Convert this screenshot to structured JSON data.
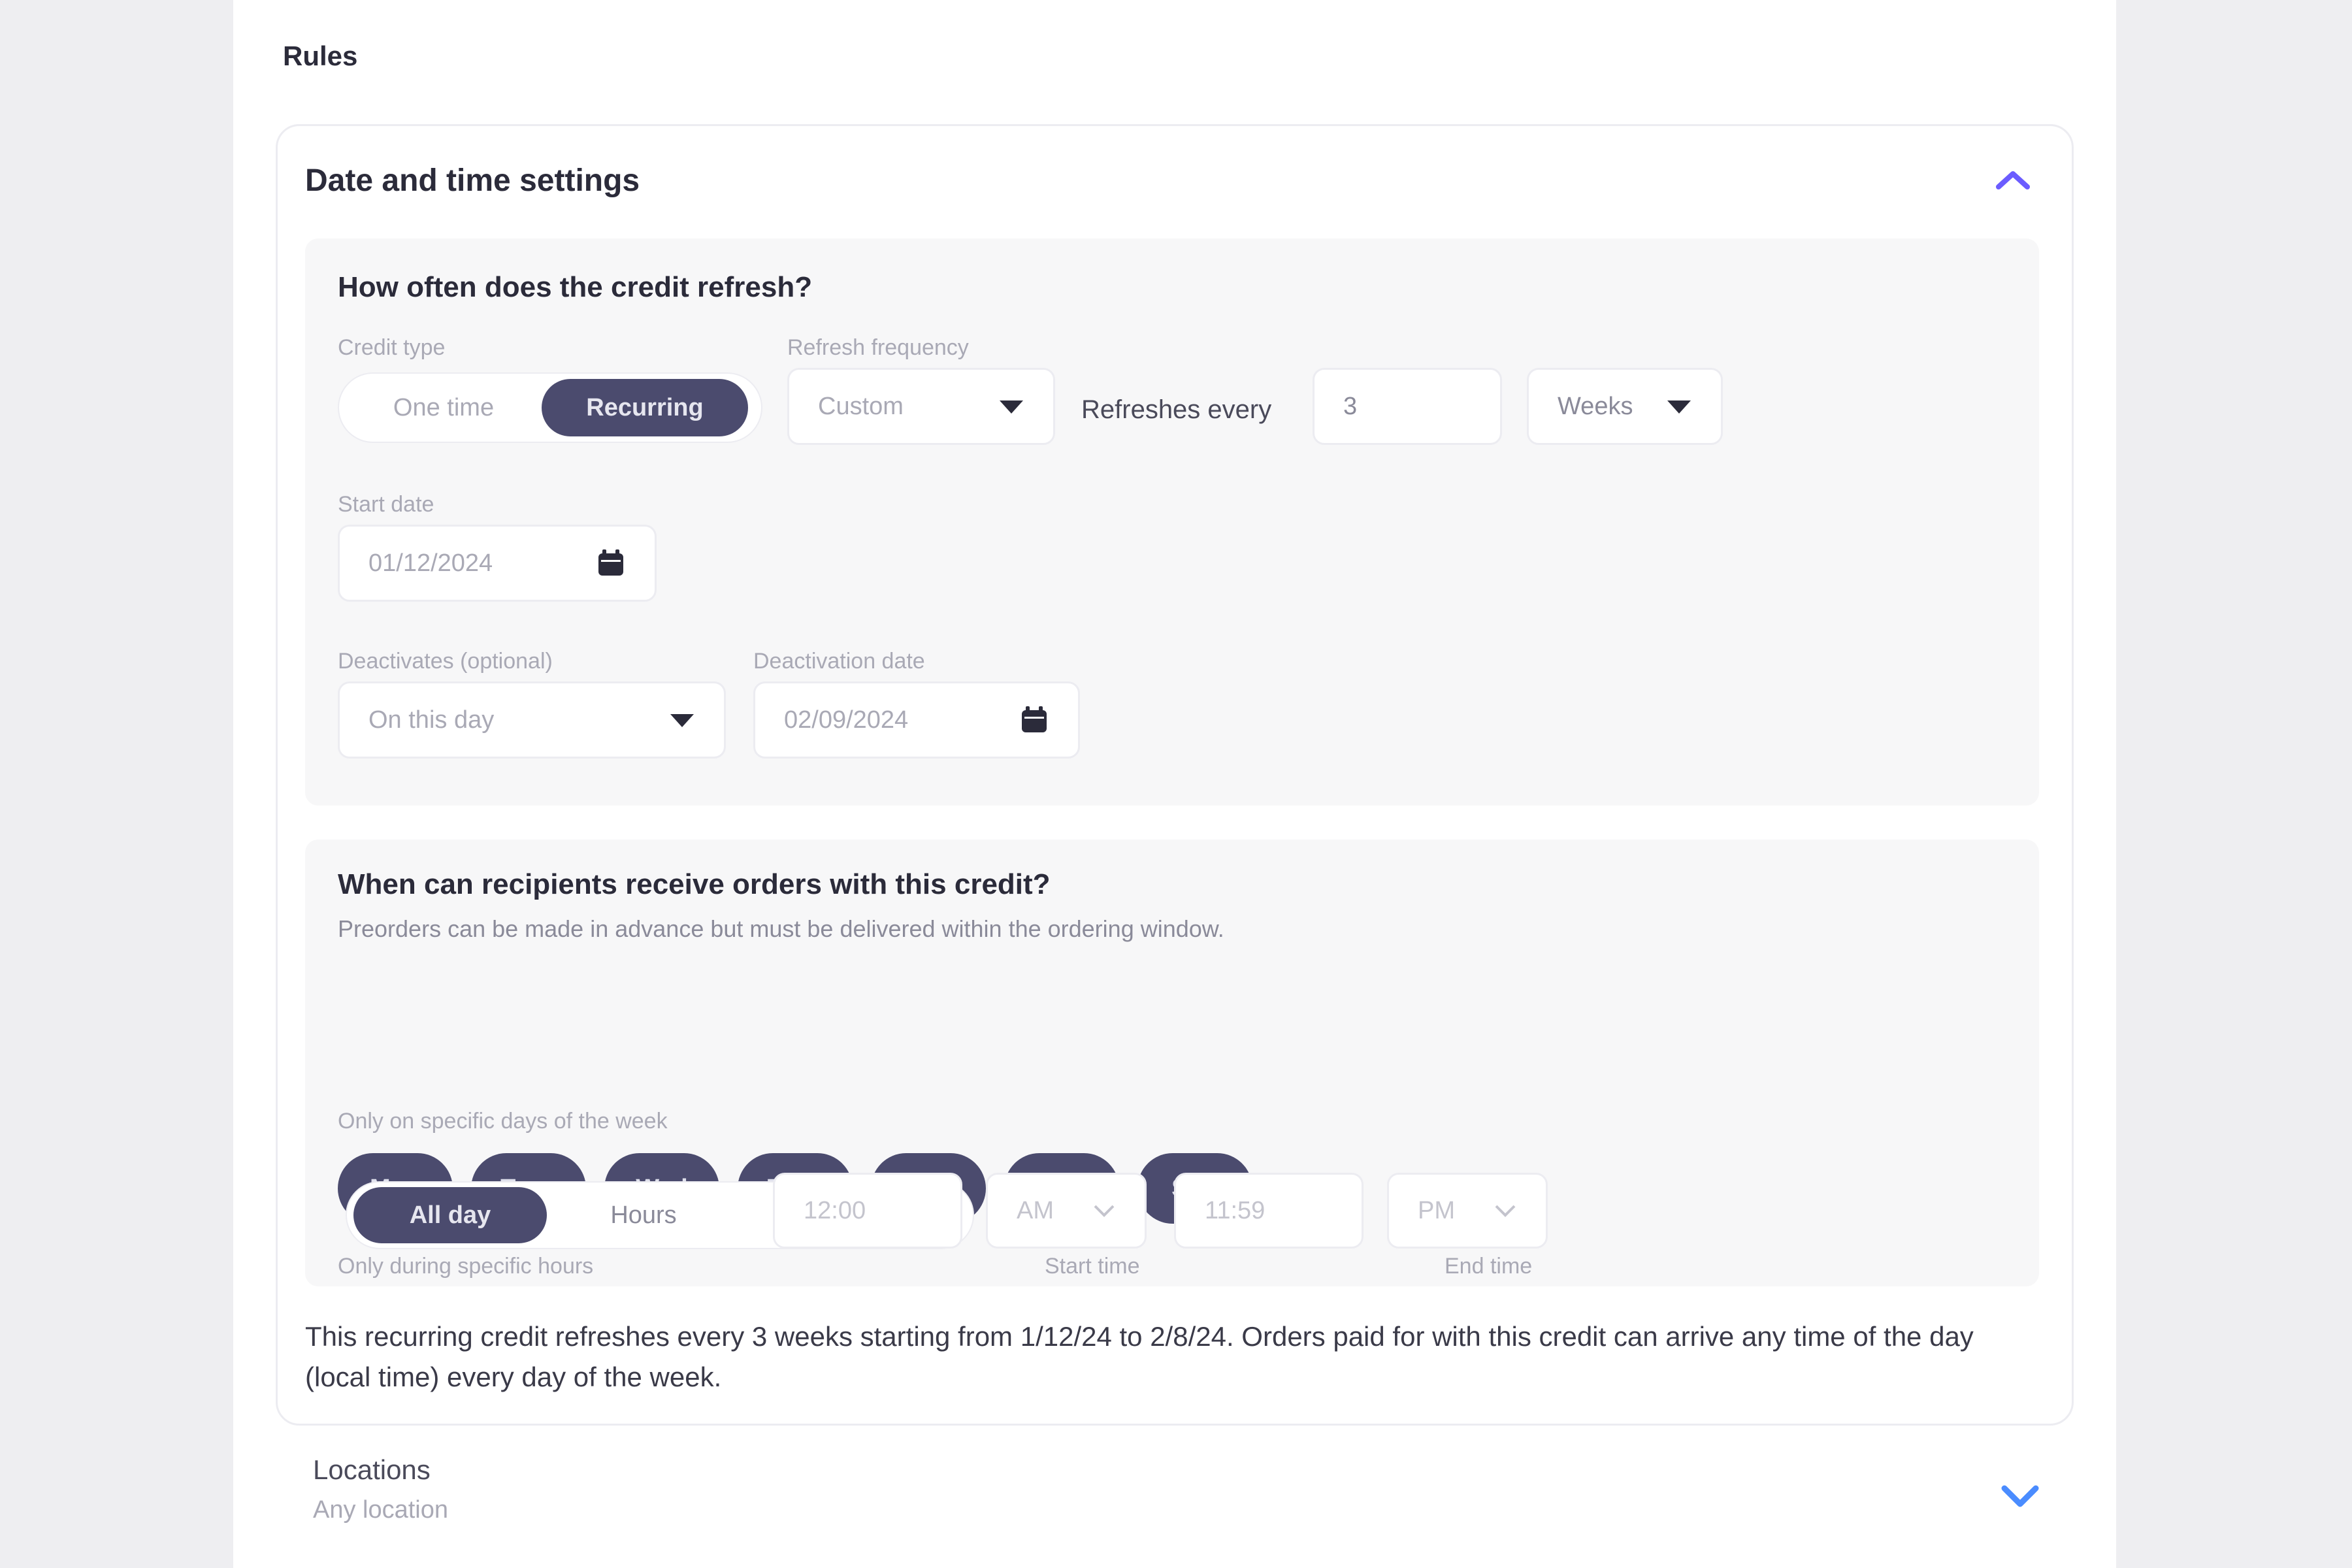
{
  "rules": {
    "title": "Rules"
  },
  "date_time": {
    "title": "Date and time settings",
    "refresh": {
      "question": "How often does the credit refresh?",
      "credit_type_label": "Credit type",
      "credit_type_options": [
        "One time",
        "Recurring"
      ],
      "credit_type_selected": "Recurring",
      "refresh_frequency_label": "Refresh frequency",
      "refresh_frequency_value": "Custom",
      "refreshes_every_label": "Refreshes every",
      "refreshes_every_value": "3",
      "period_value": "Weeks",
      "start_date_label": "Start date",
      "start_date_value": "01/12/2024",
      "deactivates_label": "Deactivates (optional)",
      "deactivates_value": "On this day",
      "deactivation_date_label": "Deactivation date",
      "deactivation_date_value": "02/09/2024"
    },
    "window": {
      "question": "When can recipients receive orders with this credit?",
      "subtitle": "Preorders can be made in advance but must be delivered within the ordering window.",
      "days_label": "Only on specific days of the week",
      "days": [
        "Mon",
        "Tues",
        "Wed",
        "Thur",
        "Fri",
        "Sat",
        "Sun"
      ],
      "hours_label": "Only during specific hours",
      "hours_options": [
        "All day",
        "Hours"
      ],
      "hours_selected": "All day",
      "start_time_label": "Start time",
      "start_time_placeholder": "12:00",
      "start_ampm": "AM",
      "end_time_label": "End time",
      "end_time_placeholder": "11:59",
      "end_ampm": "PM"
    },
    "summary": "This recurring credit refreshes every 3 weeks starting from 1/12/24 to 2/8/24. Orders paid for with this credit can arrive any time of the day (local time) every day of the week."
  },
  "locations": {
    "title": "Locations",
    "subtitle": "Any location"
  },
  "colors": {
    "accent": "#6b5cff",
    "pill_active": "#4b4b6e",
    "link_blue": "#4a8cff"
  }
}
